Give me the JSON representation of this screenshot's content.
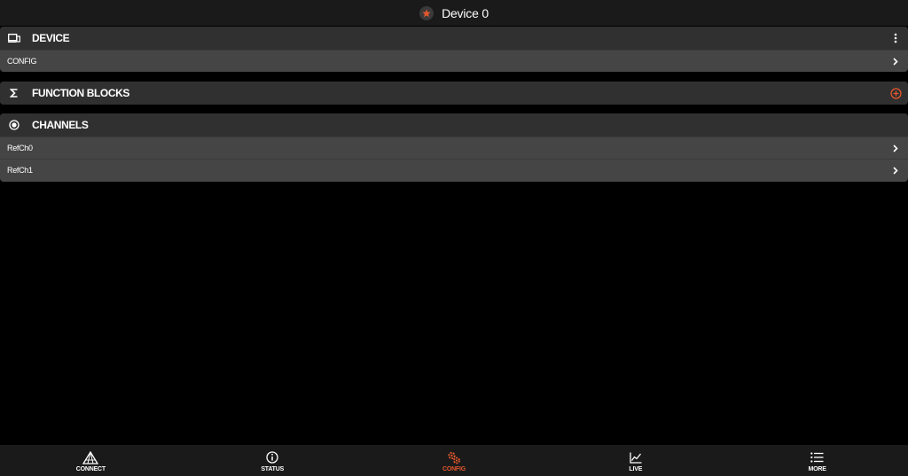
{
  "header": {
    "title": "Device 0",
    "icon": "star-badge-icon"
  },
  "colors": {
    "accent": "#e2572c",
    "background": "#000000",
    "section_header": "#303030",
    "row": "#454545"
  },
  "sections": {
    "device": {
      "title": "DEVICE",
      "icon": "device-icon",
      "action_icon": "more-vertical-icon",
      "rows": [
        {
          "label": "CONFIG"
        }
      ]
    },
    "function_blocks": {
      "title": "FUNCTION BLOCKS",
      "icon": "sigma-icon",
      "action_icon": "add-circle-icon",
      "rows": []
    },
    "channels": {
      "title": "CHANNELS",
      "icon": "radio-target-icon",
      "rows": [
        {
          "label": "RefCh0"
        },
        {
          "label": "RefCh1"
        }
      ]
    }
  },
  "nav": {
    "active": "config",
    "items": [
      {
        "id": "connect",
        "label": "CONNECT",
        "icon": "prism-icon"
      },
      {
        "id": "status",
        "label": "STATUS",
        "icon": "info-icon"
      },
      {
        "id": "config",
        "label": "CONFIG",
        "icon": "gears-icon"
      },
      {
        "id": "live",
        "label": "LIVE",
        "icon": "chart-line-icon"
      },
      {
        "id": "more",
        "label": "MORE",
        "icon": "list-icon"
      }
    ]
  }
}
